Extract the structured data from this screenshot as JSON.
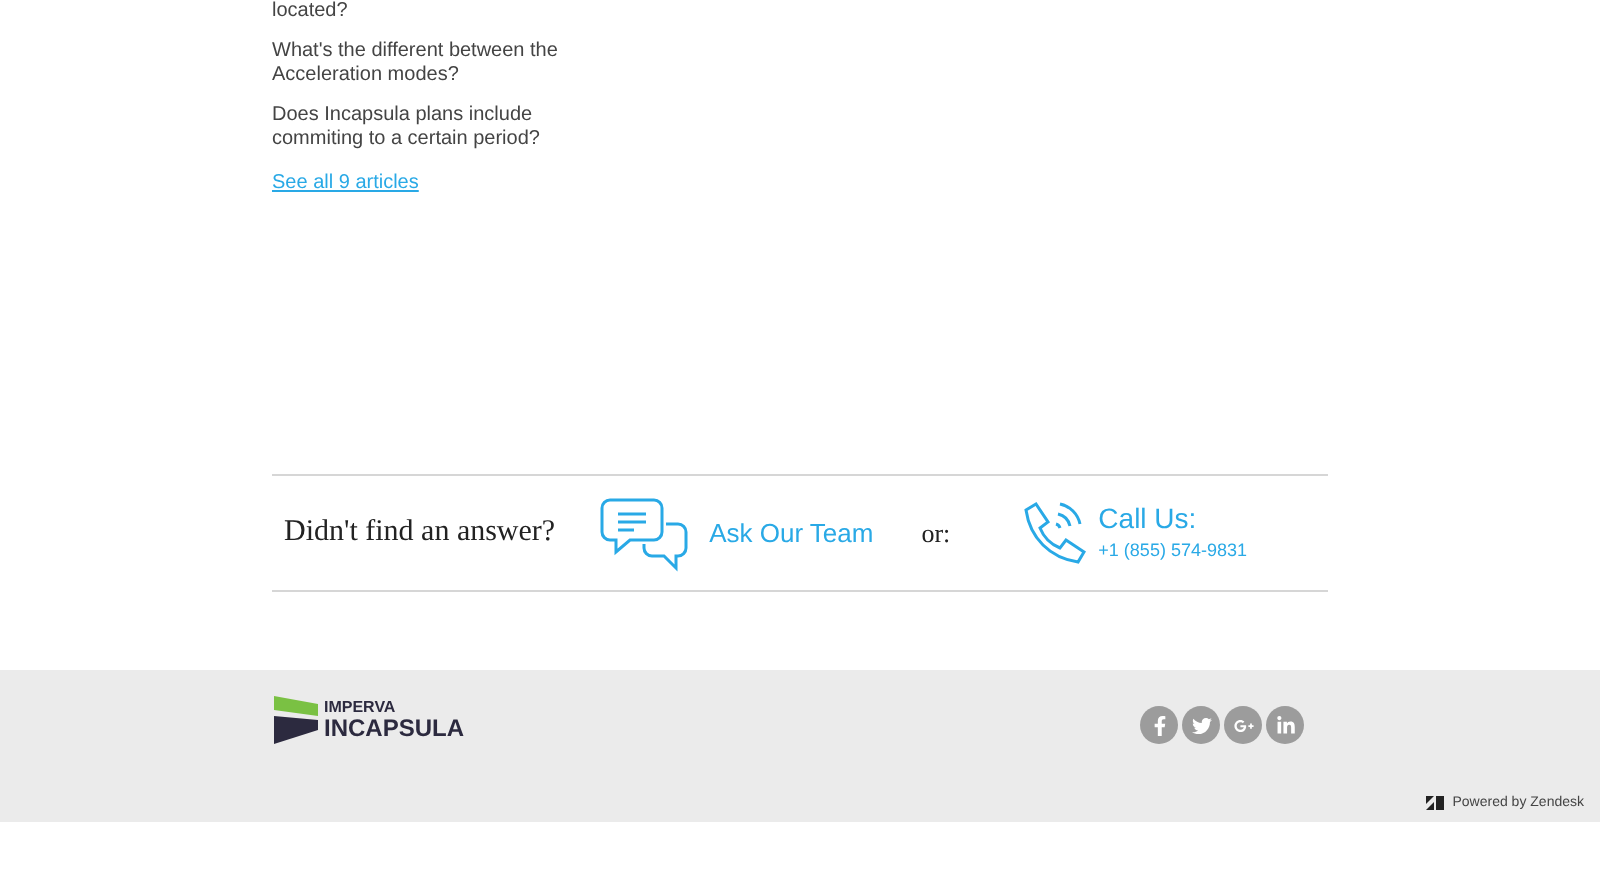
{
  "articles": [
    "located?",
    "What's the different between the Acceleration modes?",
    "Does Incapsula plans include commiting to a certain period?"
  ],
  "see_all": "See all 9 articles",
  "contact": {
    "question": "Didn't find an answer?",
    "ask": "Ask Our Team",
    "or": "or:",
    "call_title": "Call Us:",
    "phone": "+1 (855) 574-9831"
  },
  "footer": {
    "logo_top": "IMPERVA",
    "logo_bottom": "INCAPSULA",
    "social": [
      {
        "kind": "facebook"
      },
      {
        "kind": "twitter"
      },
      {
        "kind": "googleplus"
      },
      {
        "kind": "linkedin"
      }
    ],
    "powered": "Powered by Zendesk"
  }
}
